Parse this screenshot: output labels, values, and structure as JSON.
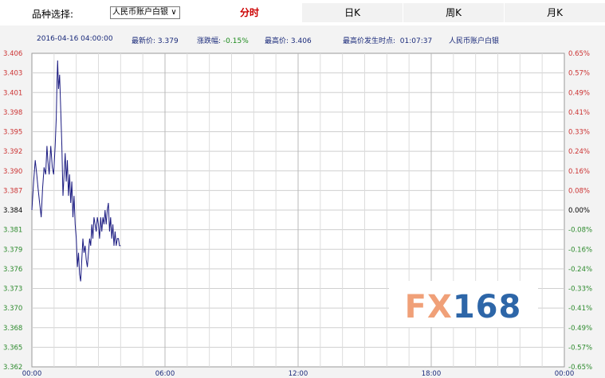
{
  "selector": {
    "label": "品种选择:",
    "value": "人民币账户白银"
  },
  "tabs": [
    {
      "label": "分时",
      "active": true
    },
    {
      "label": "日K",
      "active": false
    },
    {
      "label": "周K",
      "active": false
    },
    {
      "label": "月K",
      "active": false
    }
  ],
  "info": {
    "datetime": "2016-04-16 04:00:00",
    "latest_label": "最新价:",
    "latest_value": "3.379",
    "change_label": "涨跌幅:",
    "change_value": "-0.15%",
    "high_label": "最高价:",
    "high_value": "3.406",
    "high_time_label": "最高价发生时点:",
    "high_time_value": "01:07:37",
    "product": "人民币账户白银"
  },
  "watermark": "FX168",
  "colors": {
    "up": "#cc3333",
    "down": "#2e8b2e",
    "flat": "#000000",
    "line": "#1a1a80",
    "text_blue": "#1a2a7a",
    "fx_orange": "#f0a078",
    "fx_blue": "#2d66a8"
  },
  "chart_data": {
    "type": "line",
    "title": "",
    "xlabel": "",
    "ylabel": "",
    "x_ticks": [
      "00:00",
      "06:00",
      "12:00",
      "18:00",
      "00:00"
    ],
    "x_range_hours": [
      0,
      24
    ],
    "y_ticks": [
      "3.406",
      "3.403",
      "3.401",
      "3.398",
      "3.395",
      "3.392",
      "3.390",
      "3.387",
      "3.384",
      "3.381",
      "3.379",
      "3.376",
      "3.373",
      "3.370",
      "3.368",
      "3.365",
      "3.362"
    ],
    "y_range": [
      3.362,
      3.406
    ],
    "y_right_ticks": [
      "0.65%",
      "0.57%",
      "0.49%",
      "0.41%",
      "0.33%",
      "0.24%",
      "0.16%",
      "0.08%",
      "0.00%",
      "-0.08%",
      "-0.16%",
      "-0.24%",
      "-0.33%",
      "-0.41%",
      "-0.49%",
      "-0.57%",
      "-0.65%"
    ],
    "base_price": 3.384,
    "grid": true,
    "series": [
      {
        "x_hours": [
          0,
          0.08,
          0.15,
          0.22,
          0.28,
          0.35,
          0.42,
          0.48,
          0.55,
          0.62,
          0.68,
          0.72,
          0.78,
          0.85,
          0.92,
          0.98,
          1.05,
          1.1,
          1.13,
          1.16,
          1.2,
          1.25,
          1.3,
          1.35,
          1.4,
          1.45,
          1.5,
          1.55,
          1.6,
          1.65,
          1.7,
          1.75,
          1.8,
          1.85,
          1.9,
          1.95,
          2.0,
          2.05,
          2.1,
          2.15,
          2.2,
          2.25,
          2.3,
          2.35,
          2.4,
          2.45,
          2.5,
          2.55,
          2.6,
          2.65,
          2.7,
          2.75,
          2.8,
          2.85,
          2.9,
          2.95,
          3.0,
          3.05,
          3.1,
          3.15,
          3.2,
          3.25,
          3.3,
          3.35,
          3.4,
          3.45,
          3.5,
          3.55,
          3.6,
          3.65,
          3.7,
          3.75,
          3.8,
          3.85,
          3.9,
          3.95,
          4.0
        ],
        "values": [
          3.384,
          3.388,
          3.391,
          3.389,
          3.387,
          3.385,
          3.383,
          3.387,
          3.39,
          3.389,
          3.393,
          3.391,
          3.389,
          3.393,
          3.39,
          3.389,
          3.393,
          3.397,
          3.402,
          3.405,
          3.401,
          3.403,
          3.398,
          3.393,
          3.386,
          3.389,
          3.392,
          3.388,
          3.391,
          3.386,
          3.389,
          3.385,
          3.388,
          3.383,
          3.386,
          3.382,
          3.38,
          3.376,
          3.378,
          3.375,
          3.374,
          3.377,
          3.38,
          3.378,
          3.379,
          3.377,
          3.376,
          3.378,
          3.38,
          3.379,
          3.382,
          3.38,
          3.383,
          3.382,
          3.381,
          3.383,
          3.382,
          3.38,
          3.383,
          3.381,
          3.383,
          3.382,
          3.384,
          3.382,
          3.384,
          3.385,
          3.381,
          3.383,
          3.38,
          3.382,
          3.379,
          3.381,
          3.379,
          3.38,
          3.38,
          3.379,
          3.379
        ]
      }
    ]
  }
}
